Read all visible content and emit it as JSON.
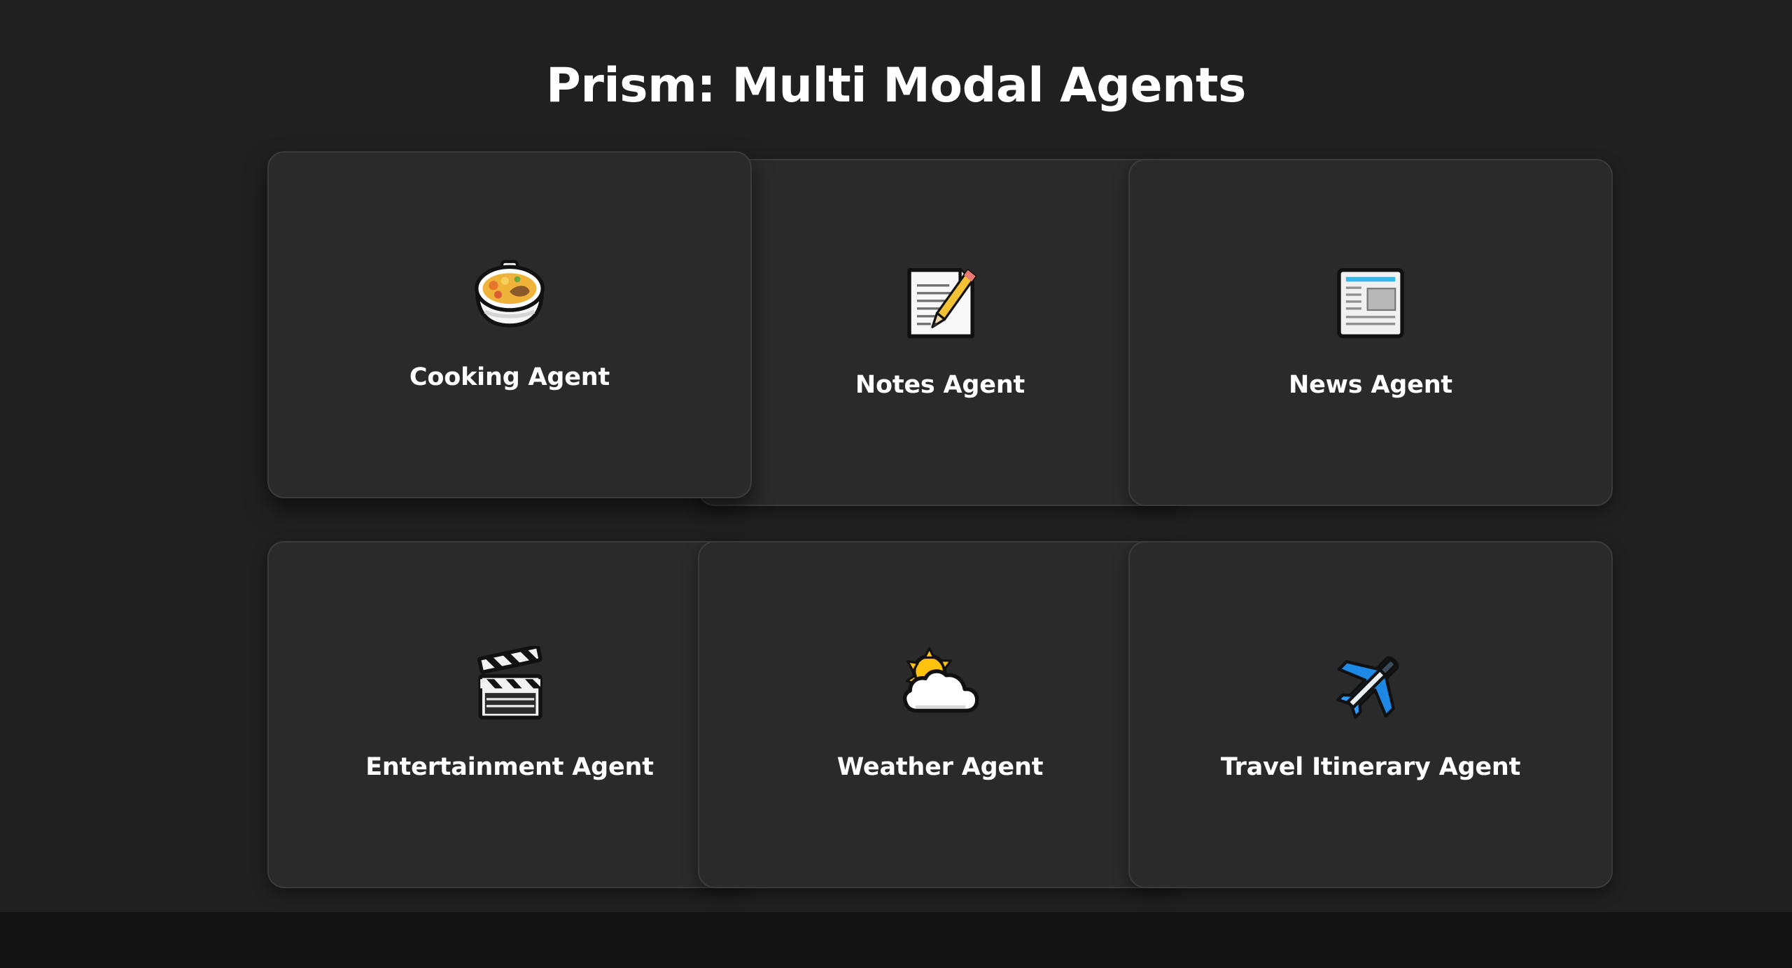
{
  "header": {
    "title": "Prism: Multi Modal Agents"
  },
  "agents": [
    {
      "label": "Cooking Agent",
      "icon": "stew-pot-icon"
    },
    {
      "label": "Notes Agent",
      "icon": "memo-pencil-icon"
    },
    {
      "label": "News Agent",
      "icon": "newspaper-icon"
    },
    {
      "label": "Entertainment Agent",
      "icon": "clapperboard-icon"
    },
    {
      "label": "Weather Agent",
      "icon": "sun-behind-cloud-icon"
    },
    {
      "label": "Travel Itinerary Agent",
      "icon": "airplane-icon"
    }
  ],
  "colors": {
    "page_background": "#202020",
    "bottom_band": "#141414",
    "card_background": "#2a2a2a",
    "card_border": "#3b3b3b",
    "text": "#ffffff"
  }
}
